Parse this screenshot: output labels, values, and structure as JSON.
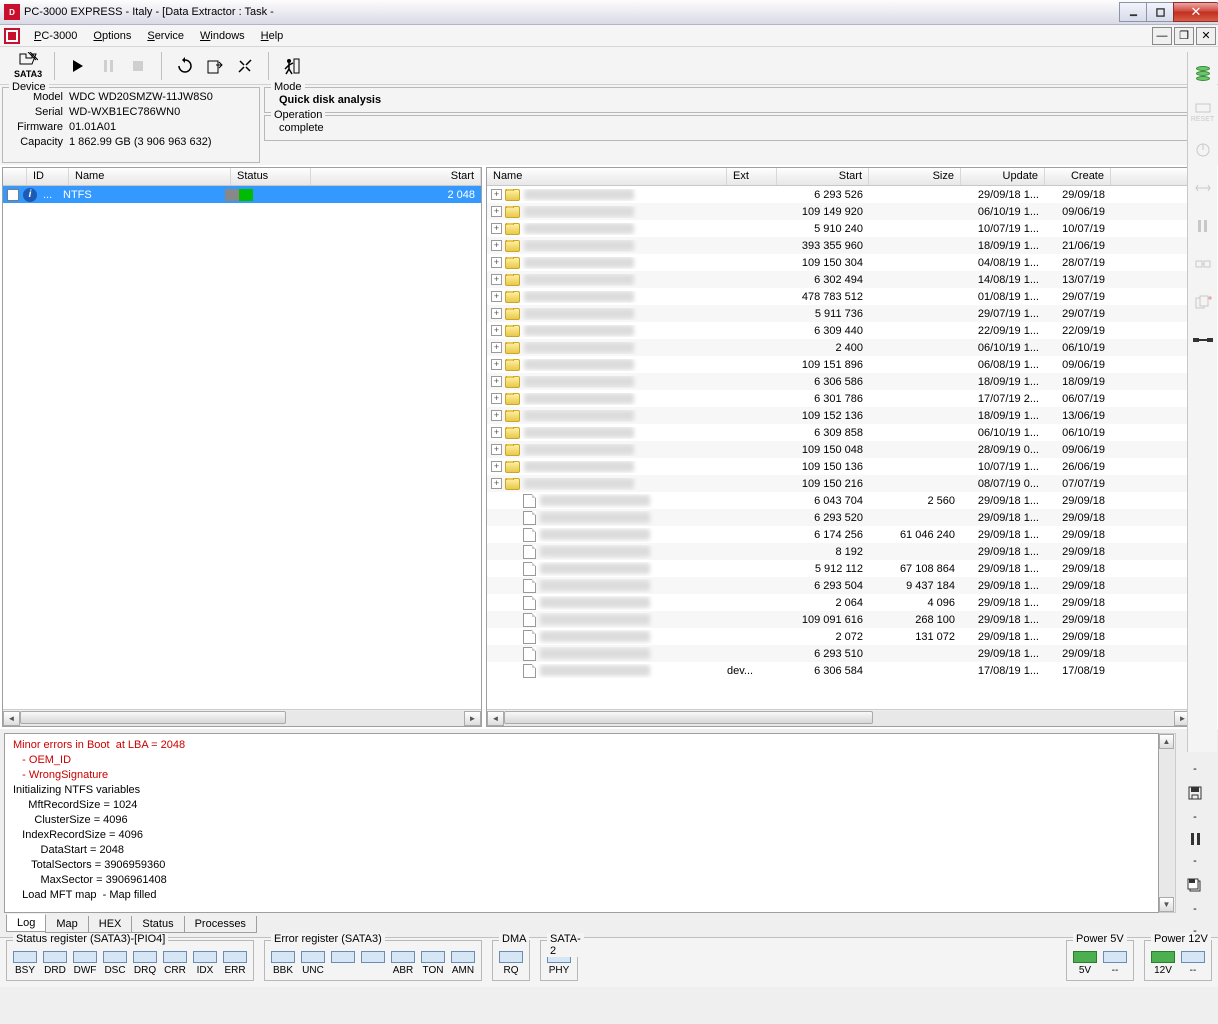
{
  "title": "PC-3000 EXPRESS - Italy - [Data Extractor : Task - ",
  "menu": [
    "PC-3000",
    "Options",
    "Service",
    "Windows",
    "Help"
  ],
  "sata_label": "SATA3",
  "device": {
    "legend": "Device",
    "model_label": "Model",
    "model": "WDC WD20SMZW-11JW8S0",
    "serial_label": "Serial",
    "serial": "WD-WXB1EC786WN0",
    "firmware_label": "Firmware",
    "firmware": "01.01A01",
    "capacity_label": "Capacity",
    "capacity": "1 862.99 GB (3 906 963 632)"
  },
  "mode": {
    "legend": "Mode",
    "value": "Quick disk  analysis"
  },
  "operation": {
    "legend": "Operation",
    "value": "complete"
  },
  "left_headers": {
    "id": "ID",
    "name": "Name",
    "status": "Status",
    "start": "Start"
  },
  "left_row": {
    "name": "NTFS",
    "start": "2 048"
  },
  "right_headers": {
    "name": "Name",
    "ext": "Ext",
    "start": "Start",
    "size": "Size",
    "update": "Update",
    "create": "Create"
  },
  "tree": [
    {
      "t": "d",
      "start": "6 293 526",
      "size": "",
      "upd": "29/09/18 1...",
      "cre": "29/09/18"
    },
    {
      "t": "d",
      "start": "109 149 920",
      "size": "",
      "upd": "06/10/19 1...",
      "cre": "09/06/19"
    },
    {
      "t": "d",
      "start": "5 910 240",
      "size": "",
      "upd": "10/07/19 1...",
      "cre": "10/07/19"
    },
    {
      "t": "d",
      "start": "393 355 960",
      "size": "",
      "upd": "18/09/19 1...",
      "cre": "21/06/19"
    },
    {
      "t": "d",
      "start": "109 150 304",
      "size": "",
      "upd": "04/08/19 1...",
      "cre": "28/07/19"
    },
    {
      "t": "d",
      "start": "6 302 494",
      "size": "",
      "upd": "14/08/19 1...",
      "cre": "13/07/19"
    },
    {
      "t": "d",
      "start": "478 783 512",
      "size": "",
      "upd": "01/08/19 1...",
      "cre": "29/07/19"
    },
    {
      "t": "d",
      "start": "5 911 736",
      "size": "",
      "upd": "29/07/19 1...",
      "cre": "29/07/19"
    },
    {
      "t": "d",
      "start": "6 309 440",
      "size": "",
      "upd": "22/09/19 1...",
      "cre": "22/09/19"
    },
    {
      "t": "d",
      "start": "2 400",
      "size": "",
      "upd": "06/10/19 1...",
      "cre": "06/10/19"
    },
    {
      "t": "d",
      "start": "109 151 896",
      "size": "",
      "upd": "06/08/19 1...",
      "cre": "09/06/19"
    },
    {
      "t": "d",
      "start": "6 306 586",
      "size": "",
      "upd": "18/09/19 1...",
      "cre": "18/09/19"
    },
    {
      "t": "d",
      "start": "6 301 786",
      "size": "",
      "upd": "17/07/19 2...",
      "cre": "06/07/19"
    },
    {
      "t": "d",
      "start": "109 152 136",
      "size": "",
      "upd": "18/09/19 1...",
      "cre": "13/06/19"
    },
    {
      "t": "d",
      "start": "6 309 858",
      "size": "",
      "upd": "06/10/19 1...",
      "cre": "06/10/19"
    },
    {
      "t": "d",
      "start": "109 150 048",
      "size": "",
      "upd": "28/09/19 0...",
      "cre": "09/06/19"
    },
    {
      "t": "d",
      "start": "109 150 136",
      "size": "",
      "upd": "10/07/19 1...",
      "cre": "26/06/19"
    },
    {
      "t": "d",
      "start": "109 150 216",
      "size": "",
      "upd": "08/07/19 0...",
      "cre": "07/07/19"
    },
    {
      "t": "f",
      "start": "6 043 704",
      "size": "2 560",
      "upd": "29/09/18 1...",
      "cre": "29/09/18"
    },
    {
      "t": "f",
      "start": "6 293 520",
      "size": "",
      "upd": "29/09/18 1...",
      "cre": "29/09/18"
    },
    {
      "t": "f",
      "start": "6 174 256",
      "size": "61 046 240",
      "upd": "29/09/18 1...",
      "cre": "29/09/18"
    },
    {
      "t": "f",
      "start": "8 192",
      "size": "",
      "upd": "29/09/18 1...",
      "cre": "29/09/18"
    },
    {
      "t": "f",
      "start": "5 912 112",
      "size": "67 108 864",
      "upd": "29/09/18 1...",
      "cre": "29/09/18"
    },
    {
      "t": "f",
      "start": "6 293 504",
      "size": "9 437 184",
      "upd": "29/09/18 1...",
      "cre": "29/09/18"
    },
    {
      "t": "f",
      "start": "2 064",
      "size": "4 096",
      "upd": "29/09/18 1...",
      "cre": "29/09/18"
    },
    {
      "t": "f",
      "start": "109 091 616",
      "size": "268 100",
      "upd": "29/09/18 1...",
      "cre": "29/09/18"
    },
    {
      "t": "f",
      "start": "2 072",
      "size": "131 072",
      "upd": "29/09/18 1...",
      "cre": "29/09/18"
    },
    {
      "t": "f",
      "start": "6 293 510",
      "size": "",
      "upd": "29/09/18 1...",
      "cre": "29/09/18"
    },
    {
      "t": "f",
      "ext": "dev...",
      "start": "6 306 584",
      "size": "",
      "upd": "17/08/19 1...",
      "cre": "17/08/19"
    }
  ],
  "log": {
    "err1": "Minor errors in Boot  at LBA = 2048",
    "err2": "   - OEM_ID",
    "err3": "   - WrongSignature",
    "l1": "Initializing NTFS variables",
    "l2": "     MftRecordSize = 1024",
    "l3": "       ClusterSize = 4096",
    "l4": "   IndexRecordSize = 4096",
    "l5": "         DataStart = 2048",
    "l6": "      TotalSectors = 3906959360",
    "l7": "         MaxSector = 3906961408",
    "l8": "   Load MFT map  - Map filled"
  },
  "log_tabs": [
    "Log",
    "Map",
    "HEX",
    "Status",
    "Processes"
  ],
  "status_reg": {
    "legend": "Status register (SATA3)-[PIO4]",
    "items": [
      "BSY",
      "DRD",
      "DWF",
      "DSC",
      "DRQ",
      "CRR",
      "IDX",
      "ERR"
    ]
  },
  "error_reg": {
    "legend": "Error register (SATA3)",
    "items": [
      "BBK",
      "UNC",
      "",
      "",
      "ABR",
      "TON",
      "AMN"
    ]
  },
  "dma": {
    "legend": "DMA",
    "items": [
      "RQ"
    ]
  },
  "sata2": {
    "legend": "SATA-2",
    "items": [
      "PHY"
    ]
  },
  "power5": {
    "legend": "Power 5V",
    "label": "5V"
  },
  "power12": {
    "legend": "Power 12V",
    "label": "12V"
  },
  "reset_label": "RESET"
}
